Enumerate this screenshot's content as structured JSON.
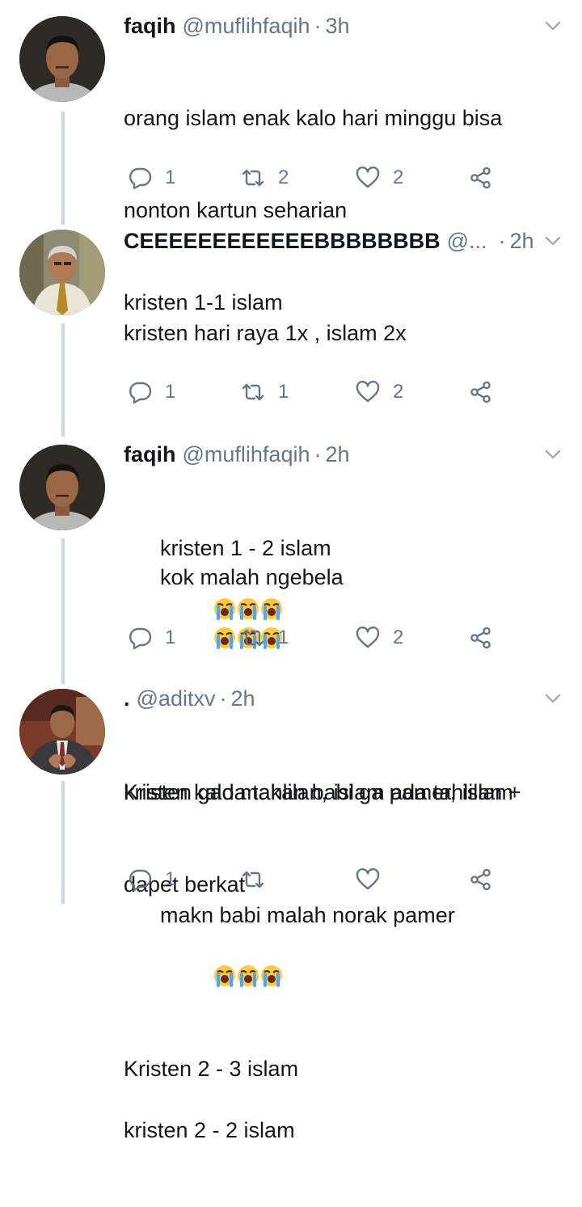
{
  "tweets": [
    {
      "name": "faqih",
      "handle": "@muflihfaqih",
      "separator": "·",
      "time": "3h",
      "lines": [
        "orang islam enak kalo hari minggu bisa",
        "nonton kartun seharian",
        "kristen 1-1 islam"
      ],
      "replies": "1",
      "retweets": "2",
      "likes": "2"
    },
    {
      "name": "CEEEEEEEEEEEEBBBBBBBB",
      "handle": "@...",
      "separator": "·",
      "time": "2h",
      "lines": [
        "kristen hari raya 1x , islam 2x",
        "",
        "kristen 1 - 2 islam"
      ],
      "replies": "1",
      "retweets": "1",
      "likes": "2"
    },
    {
      "name": "faqih",
      "handle": "@muflihfaqih",
      "separator": "·",
      "time": "2h",
      "lines": [
        "kok malah ngebela",
        "kristen kalo makan babi ga pamer, islam",
        "makn babi malah norak pamer",
        "kristen 2 - 2 islam"
      ],
      "replies": "1",
      "retweets": "1",
      "likes": "2"
    },
    {
      "name": ".",
      "handle": "@aditxv",
      "separator": "·",
      "time": "2h",
      "lines": [
        "Kristen gada tahlilan, islam ada tahlilan +",
        "dapet berkat",
        "",
        "Kristen 2 - 3 islam"
      ],
      "replies": "1",
      "retweets": "",
      "likes": ""
    }
  ],
  "emoji_name": "loudly-crying-face",
  "icons": [
    "reply-icon",
    "retweet-icon",
    "like-icon",
    "share-icon",
    "chevron-down-icon"
  ],
  "colors": {
    "text": "#14171a",
    "muted": "#657786",
    "thread": "#ccd6dd"
  }
}
